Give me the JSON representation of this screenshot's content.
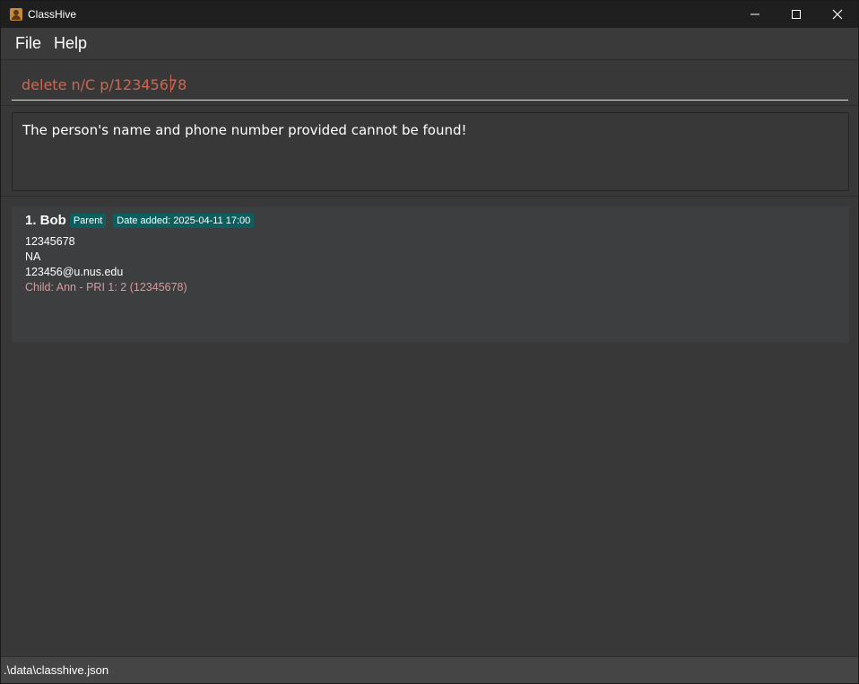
{
  "window": {
    "title": "ClassHive"
  },
  "menu": {
    "items": [
      "File",
      "Help"
    ]
  },
  "command": {
    "value": "delete n/C p/12345678"
  },
  "result": {
    "message": "The person's name and phone number provided cannot be found!"
  },
  "persons": [
    {
      "index_name": "1. Bob",
      "tags": [
        "Parent",
        "Date added: 2025-04-11 17:00"
      ],
      "phone": "12345678",
      "address": "NA",
      "email": "123456@u.nus.edu",
      "child": "Child: Ann - PRI 1: 2 (12345678)"
    }
  ],
  "status": {
    "path": ".\\data\\classhive.json"
  },
  "colors": {
    "background": "#383838",
    "titlebar": "#1f1f1f",
    "command_text": "#d06651",
    "tag_bg": "#0d5e5e",
    "child_text": "#d79aa0"
  },
  "icons": {
    "app": "classhive-app-icon",
    "minimize": "minimize-icon",
    "maximize": "maximize-icon",
    "close": "close-icon"
  }
}
